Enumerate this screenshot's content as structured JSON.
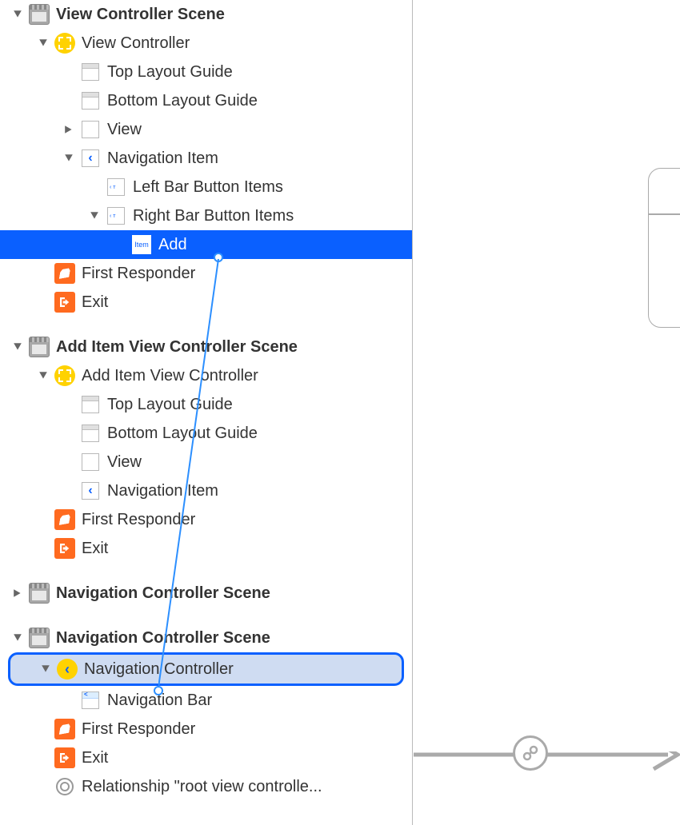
{
  "scenes": [
    {
      "label": "View Controller Scene",
      "expanded": true,
      "items": {
        "vc": {
          "label": "View Controller",
          "expanded": true
        },
        "topGuide": {
          "label": "Top Layout Guide"
        },
        "bottomGuide": {
          "label": "Bottom Layout Guide"
        },
        "view": {
          "label": "View",
          "expanded": false
        },
        "navItem": {
          "label": "Navigation Item",
          "expanded": true
        },
        "leftBar": {
          "label": "Left Bar Button Items"
        },
        "rightBar": {
          "label": "Right Bar Button Items",
          "expanded": true
        },
        "addItem": {
          "label": "Add",
          "itemText": "Item",
          "selected": true
        },
        "firstResponder": {
          "label": "First Responder"
        },
        "exit": {
          "label": "Exit"
        }
      }
    },
    {
      "label": "Add Item View Controller Scene",
      "expanded": true,
      "items": {
        "vc": {
          "label": "Add Item View Controller",
          "expanded": true
        },
        "topGuide": {
          "label": "Top Layout Guide"
        },
        "bottomGuide": {
          "label": "Bottom Layout Guide"
        },
        "view": {
          "label": "View"
        },
        "navItem": {
          "label": "Navigation Item"
        },
        "firstResponder": {
          "label": "First Responder"
        },
        "exit": {
          "label": "Exit"
        }
      }
    },
    {
      "label": "Navigation Controller Scene",
      "expanded": false
    },
    {
      "label": "Navigation Controller Scene",
      "expanded": true,
      "items": {
        "vc": {
          "label": "Navigation Controller",
          "expanded": true,
          "dropTarget": true
        },
        "navBar": {
          "label": "Navigation Bar"
        },
        "firstResponder": {
          "label": "First Responder"
        },
        "exit": {
          "label": "Exit"
        },
        "relationship": {
          "label": "Relationship \"root view controlle..."
        }
      }
    }
  ],
  "icons": {
    "navChevron": "‹",
    "addItemTag": "Item"
  }
}
